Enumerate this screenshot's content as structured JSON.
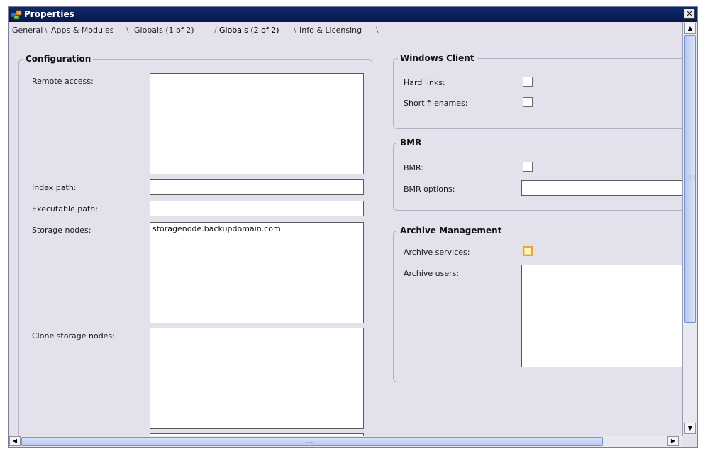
{
  "window": {
    "title": "Properties",
    "close_glyph": "✕"
  },
  "tabs": [
    {
      "label": "General"
    },
    {
      "label": "Apps & Modules"
    },
    {
      "label": "Globals (1 of 2)"
    },
    {
      "label": "Globals (2 of 2)",
      "selected": true
    },
    {
      "label": "Info & Licensing"
    }
  ],
  "configuration": {
    "legend": "Configuration",
    "remote_access": {
      "label": "Remote access:",
      "value": ""
    },
    "index_path": {
      "label": "Index path:",
      "value": ""
    },
    "executable_path": {
      "label": "Executable path:",
      "value": ""
    },
    "storage_nodes": {
      "label": "Storage nodes:",
      "value": "storagenode.backupdomain.com"
    },
    "clone_storage_nodes": {
      "label": "Clone storage nodes:",
      "value": ""
    }
  },
  "windows_client": {
    "legend": "Windows Client",
    "hard_links": {
      "label": "Hard links:",
      "checked": false
    },
    "short_filenames": {
      "label": "Short filenames:",
      "checked": false
    }
  },
  "bmr": {
    "legend": "BMR",
    "bmr": {
      "label": "BMR:",
      "checked": false
    },
    "bmr_options": {
      "label": "BMR options:",
      "value": ""
    }
  },
  "archive": {
    "legend": "Archive Management",
    "archive_services": {
      "label": "Archive services:",
      "checked": false
    },
    "archive_users": {
      "label": "Archive users:",
      "value": ""
    }
  },
  "scroll": {
    "up": "▲",
    "down": "▼",
    "left": "◀",
    "right": "▶",
    "grip_v": "⋮⋮",
    "grip_h": "::::::"
  },
  "colors": {
    "titlebar": "#0f2a6c",
    "background": "#e3e1ec",
    "highlight_checkbox": "#f5d670"
  },
  "icons": {
    "app": "properties-app-icon"
  }
}
